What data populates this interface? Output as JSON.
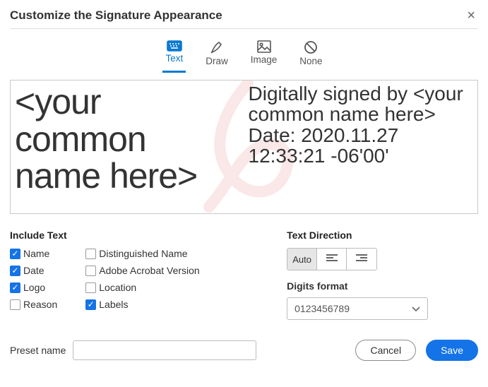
{
  "title": "Customize the Signature Appearance",
  "tabs": {
    "text": "Text",
    "draw": "Draw",
    "image": "Image",
    "none": "None",
    "active": "text"
  },
  "preview": {
    "left": "<your common name here>",
    "right": "Digitally signed by <your common name here>\nDate: 2020.11.27 12:33:21 -06'00'"
  },
  "include": {
    "heading": "Include Text",
    "name": {
      "label": "Name",
      "checked": true
    },
    "date": {
      "label": "Date",
      "checked": true
    },
    "logo": {
      "label": "Logo",
      "checked": true
    },
    "reason": {
      "label": "Reason",
      "checked": false
    },
    "dn": {
      "label": "Distinguished Name",
      "checked": false
    },
    "ver": {
      "label": "Adobe Acrobat Version",
      "checked": false
    },
    "loc": {
      "label": "Location",
      "checked": false
    },
    "labels": {
      "label": "Labels",
      "checked": true
    }
  },
  "direction": {
    "heading": "Text Direction",
    "auto": "Auto"
  },
  "digits": {
    "heading": "Digits format",
    "value": "0123456789"
  },
  "preset": {
    "label": "Preset name",
    "value": ""
  },
  "buttons": {
    "cancel": "Cancel",
    "save": "Save"
  }
}
